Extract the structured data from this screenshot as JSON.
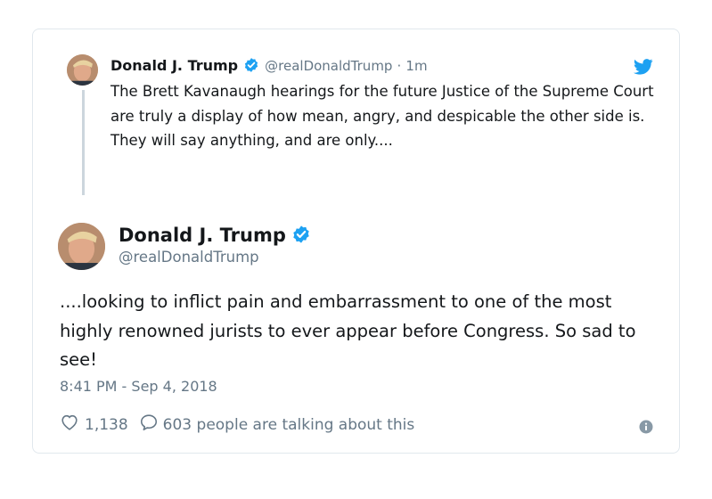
{
  "parent_tweet": {
    "name": "Donald J. Trump",
    "handle": "@realDonaldTrump",
    "separator": "·",
    "time": "1m",
    "text": "The Brett Kavanaugh hearings for the future Justice of the Supreme Court are truly a display of how mean, angry, and despicable the other side is. They will say anything, and are only...."
  },
  "main_tweet": {
    "name": "Donald J. Trump",
    "handle": "@realDonaldTrump",
    "text": "....looking to inflict pain and embarrassment to one of the most highly renowned jurists to ever appear before Congress. So sad to see!",
    "timestamp": "8:41 PM - Sep 4, 2018",
    "likes": "1,138",
    "talking": "603 people are talking about this"
  },
  "icons": {
    "verified": "verified-badge-icon",
    "bird": "twitter-bird-icon",
    "heart": "heart-icon",
    "reply": "speech-bubble-icon",
    "info": "info-icon"
  },
  "colors": {
    "brand_blue": "#1da1f2",
    "text": "#14171a",
    "muted": "#657786",
    "border": "#e1e8ed"
  }
}
